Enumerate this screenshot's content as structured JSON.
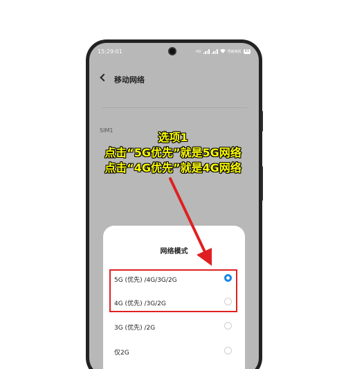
{
  "status": {
    "time": "15:29:01",
    "right_text": "HD",
    "carrier": "导航用机",
    "battery": "63",
    "icons": [
      "camera-icon",
      "signal-icon",
      "wifi-icon",
      "battery-icon"
    ]
  },
  "appbar": {
    "title": "移动网络",
    "back_icon": "chevron-left-icon"
  },
  "sim_label": "SIM1",
  "sheet": {
    "title": "网络模式",
    "options": [
      {
        "label": "5G (优先) /4G/3G/2G",
        "selected": true
      },
      {
        "label": "4G (优先) /3G/2G",
        "selected": false
      },
      {
        "label": "3G (优先) /2G",
        "selected": false
      },
      {
        "label": "仅2G",
        "selected": false
      }
    ]
  },
  "annotation": {
    "line1": "选项1",
    "line2": "点击“5G优先”就是5G网络",
    "line3": "点击“4G优先”就是4G网络",
    "text_color": "#ffff00",
    "arrow_color": "#e02020",
    "box_color": "#e02020"
  },
  "colors": {
    "screen_bg": "#b8b8b8",
    "accent": "#1a86e8"
  }
}
